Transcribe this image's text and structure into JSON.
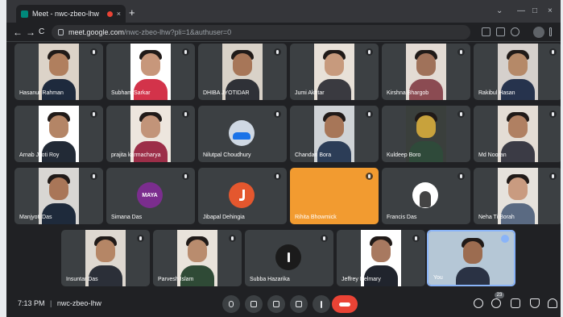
{
  "browser": {
    "tab_title": "Meet - nwc-zbeo-lhw",
    "tab_close": "×",
    "new_tab": "+",
    "url_domain": "meet.google.com",
    "url_path": "/nwc-zbeo-lhw?pli=1&authuser=0",
    "window_min": "⌄",
    "window_restore": "—",
    "window_max": "□",
    "window_close": "×",
    "nav_back": "←",
    "nav_forward": "→",
    "nav_reload": "C"
  },
  "participants": [
    {
      "name": "Hasanur Rahman",
      "kind": "photo",
      "face": "#b07f5e",
      "bg": "#dcd3c8",
      "shirt": "#1e2a3d"
    },
    {
      "name": "Subham Sarkar",
      "kind": "photo",
      "face": "#c7977b",
      "bg": "#ffffff",
      "shirt": "#d3334a"
    },
    {
      "name": "DHIBA JYOTIDAR",
      "kind": "photo",
      "face": "#a77658",
      "bg": "#d9d2c8",
      "shirt": "#2f3137"
    },
    {
      "name": "Jumi Akhtar",
      "kind": "photo",
      "face": "#c79a7d",
      "bg": "#e8e1d8",
      "shirt": "#3a3a40"
    },
    {
      "name": "Kirshna Bhargob",
      "kind": "photo",
      "face": "#a0725a",
      "bg": "#e3dbd4",
      "shirt": "#8b4b52"
    },
    {
      "name": "Rakibul Hasan",
      "kind": "photo",
      "face": "#b58968",
      "bg": "#d5d0cc",
      "shirt": "#26334d"
    },
    {
      "name": "Arnab Jyoti Roy",
      "kind": "photo",
      "face": "#b48566",
      "bg": "#ffffff",
      "shirt": "#222a36"
    },
    {
      "name": "prajita karmacharya",
      "kind": "photo",
      "face": "#c29479",
      "bg": "#ede6de",
      "shirt": "#9c2e48"
    },
    {
      "name": "Nilutpal Choudhury",
      "kind": "avatar",
      "color": "#1a73e8",
      "label": "car"
    },
    {
      "name": "Chandan Bora",
      "kind": "photo",
      "face": "#a77658",
      "bg": "#cfd3d6",
      "shirt": "#2c3d57"
    },
    {
      "name": "Kuldeep Boro",
      "kind": "photo",
      "face": "#c8a23c",
      "bg": "#3a3f3c",
      "shirt": "#2f4a3a"
    },
    {
      "name": "Md Nooran",
      "kind": "photo",
      "face": "#b08062",
      "bg": "#e4ddd5",
      "shirt": "#3b3b45"
    },
    {
      "name": "Manjyoti Das",
      "kind": "photo",
      "face": "#a97658",
      "bg": "#d8d6d3",
      "shirt": "#1e2a3b"
    },
    {
      "name": "Simana Das",
      "kind": "avatar",
      "color": "#7b2d8e",
      "label": "MAYA"
    },
    {
      "name": "Jibapal Dehingia",
      "kind": "avatar",
      "color": "#e4572e",
      "label": "J"
    },
    {
      "name": "Rihita Bhowmick",
      "kind": "orange",
      "color": "#f29b30"
    },
    {
      "name": "Francis Das",
      "kind": "avatar",
      "color": "#ffffff",
      "label": "person"
    },
    {
      "name": "Neha Ti Borah",
      "kind": "photo",
      "face": "#c99b80",
      "bg": "#e6e2dc",
      "shirt": "#5a6a82"
    },
    {
      "name": "Insuntar Das",
      "kind": "photo",
      "face": "#b58666",
      "bg": "#ded8d0",
      "shirt": "#2b2f38"
    },
    {
      "name": "Parvesh Islam",
      "kind": "photo",
      "face": "#b98c6e",
      "bg": "#e9e3db",
      "shirt": "#2f4a36"
    },
    {
      "name": "Subba Hazarika",
      "kind": "avatar",
      "color": "#1b1b1b",
      "label": "candle"
    },
    {
      "name": "Jeffrey Delmary",
      "kind": "photo",
      "face": "#a87960",
      "bg": "#ffffff",
      "shirt": "#20242d"
    },
    {
      "name": "You",
      "kind": "self",
      "face": "#9c6c50",
      "bg": "#b5c7d6",
      "shirt": "#2a3244"
    }
  ],
  "bottom_bar": {
    "time": "7:13 PM",
    "separator": "|",
    "meeting_code": "nwc-zbeo-lhw",
    "people_count": "23"
  },
  "colors": {
    "end_call": "#ea4335",
    "tile_bg": "#3c4043",
    "meet_bg": "#202124"
  }
}
